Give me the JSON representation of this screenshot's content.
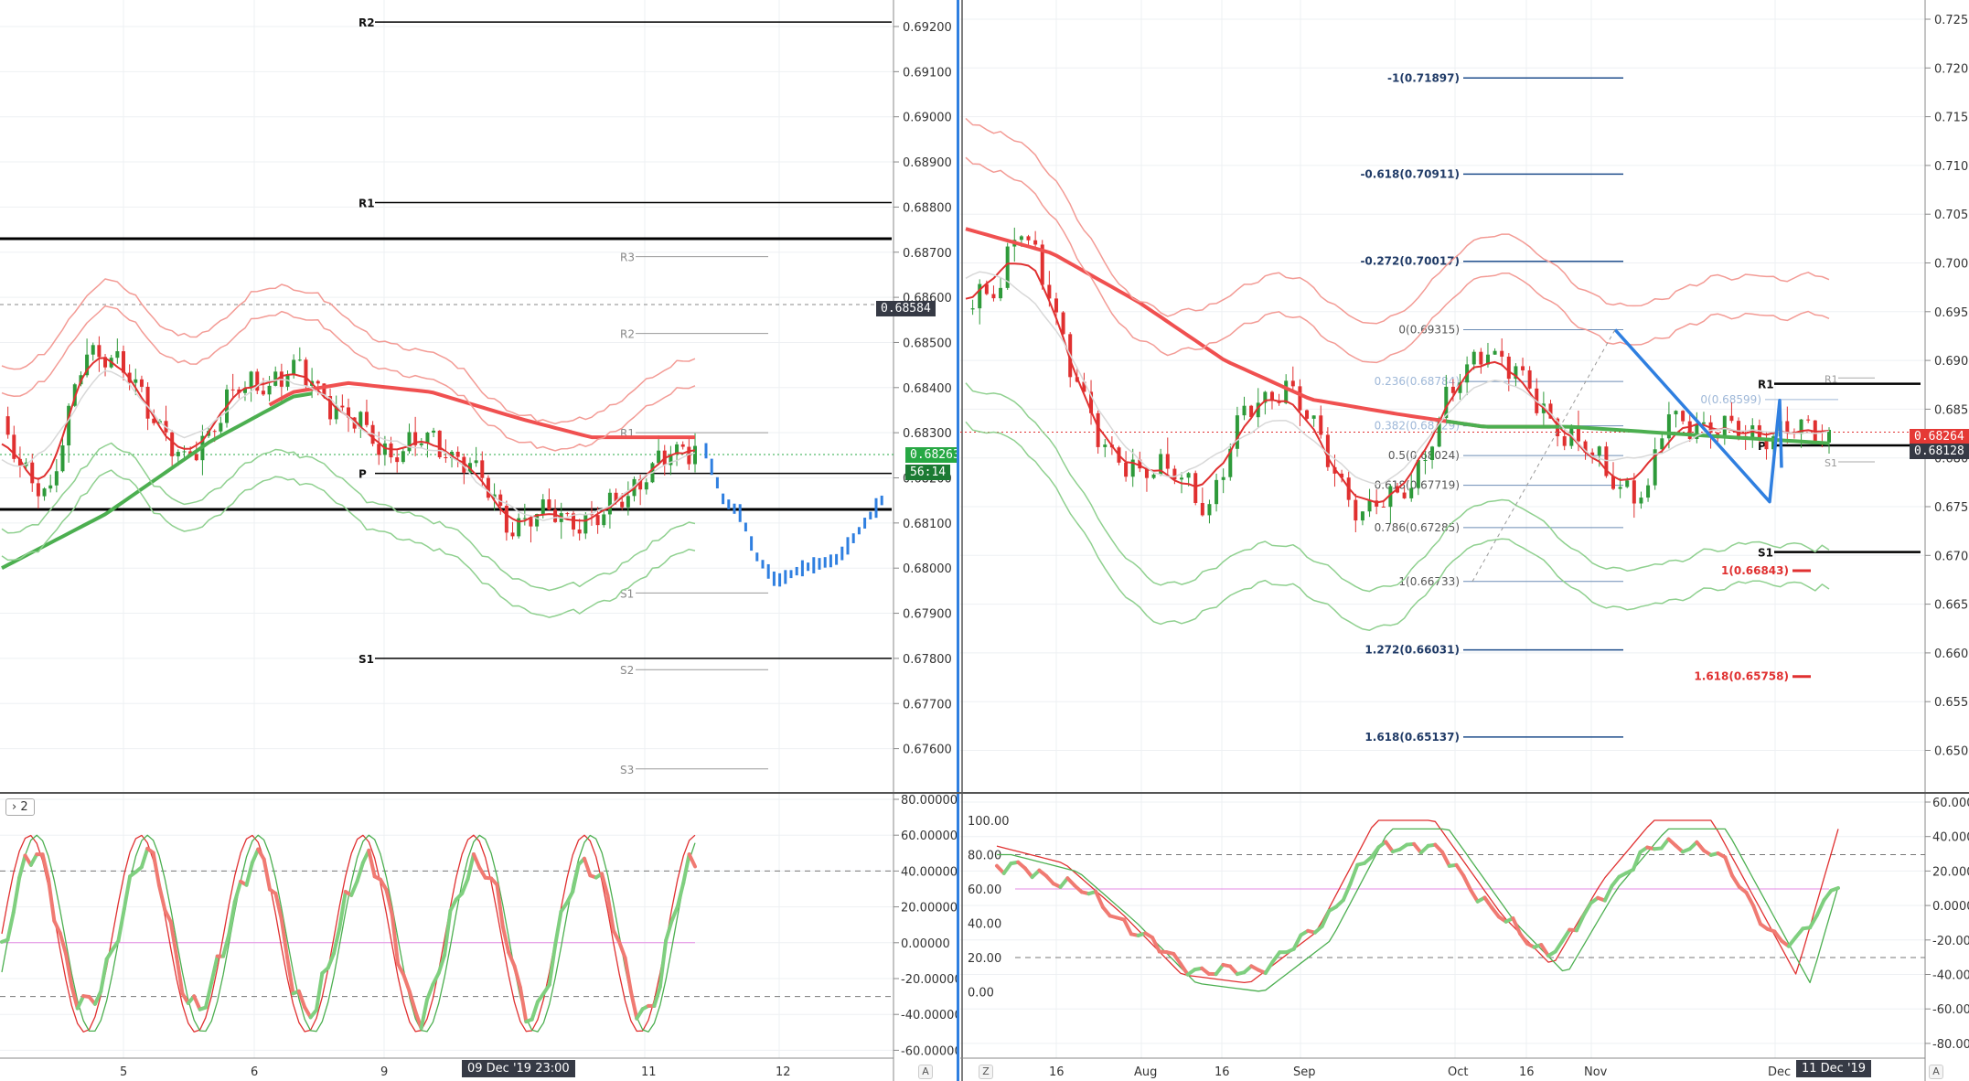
{
  "left_chart": {
    "price_axis": [
      "0.69200",
      "0.69100",
      "0.69000",
      "0.68900",
      "0.68800",
      "0.68700",
      "0.68600",
      "0.68500",
      "0.68400",
      "0.68300",
      "0.68200",
      "0.68100",
      "0.68000",
      "0.67900",
      "0.67800",
      "0.67700",
      "0.67600"
    ],
    "time_axis": [
      "5",
      "6",
      "9",
      "11",
      "12"
    ],
    "crosshair_date": "09 Dec '19  23:00",
    "crosshair_price": "0.68584",
    "last_price": "0.68263",
    "countdown": "56:14",
    "pivot_labels": {
      "R2": "R2",
      "R1": "R1",
      "P": "P",
      "S1": "S1",
      "R3_small": "R3",
      "R2_small": "R2",
      "R1_small": "R1",
      "S1_small": "S1",
      "S2_small": "S2",
      "S3_small": "S3"
    },
    "osc_axis": [
      "80.00000",
      "60.00000",
      "40.00000",
      "20.00000",
      "0.00000",
      "-20.00000",
      "-40.00000",
      "-60.00000"
    ],
    "osc_button": "2",
    "corner": "A"
  },
  "right_chart": {
    "price_axis": [
      "0.72500",
      "0.72000",
      "0.71500",
      "0.71000",
      "0.70500",
      "0.70000",
      "0.69500",
      "0.69000",
      "0.68500",
      "0.68000",
      "0.67500",
      "0.67000",
      "0.66500",
      "0.66000",
      "0.65500",
      "0.65000"
    ],
    "time_axis": [
      "16",
      "Aug",
      "16",
      "Sep",
      "Oct",
      "16",
      "Nov",
      "Dec"
    ],
    "crosshair_date": "11 Dec '19",
    "last_price": "0.68264",
    "pivot_price": "0.68128",
    "fib_labels": [
      "-1(0.71897)",
      "-0.618(0.70911)",
      "-0.272(0.70017)",
      "0(0.69315)",
      "0.236(0.68784)",
      "0.382(0.68329)",
      "0.5(0.68024)",
      "0.618(0.67719)",
      "0.786(0.67285)",
      "1(0.66733)",
      "1.272(0.66031)",
      "1.618(0.65137)"
    ],
    "small_fib_labels": [
      "0(0.68599)",
      "1(0.66843)",
      "1.618(0.65758)"
    ],
    "pivot_labels": {
      "R1": "R1",
      "P": "P",
      "S1": "S1",
      "R1_small": "R1",
      "S1_small": "S1"
    },
    "osc_left_axis": [
      "100.00",
      "80.00",
      "60.00",
      "40.00",
      "20.00",
      "0.00"
    ],
    "osc_right_axis": [
      "60.00000",
      "40.00000",
      "20.00000",
      "0.00000",
      "-20.00000",
      "-40.00000",
      "-60.00000",
      "-80.00000"
    ],
    "corner_z": "Z",
    "corner_a": "A"
  },
  "colors": {
    "up": "#2e9a3a",
    "down": "#e03030",
    "blue": "#2f7fe0",
    "red_line": "#f05050",
    "green_line": "#4caf50"
  }
}
